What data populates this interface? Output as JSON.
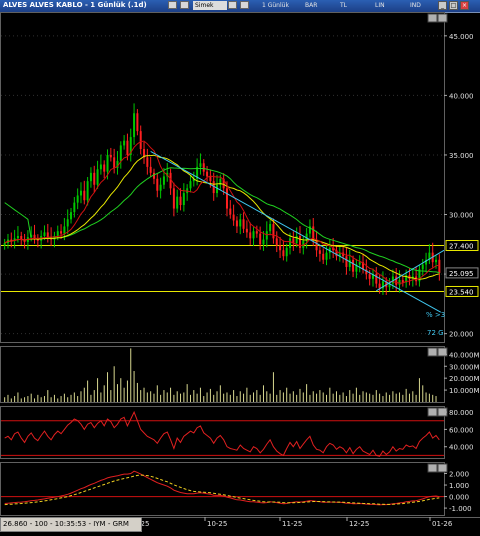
{
  "window": {
    "title": "ALVES ALVES KABLO - 1 Günlük (.1d)",
    "toolbar": {
      "field1": "Simek",
      "period": "1 Günlük",
      "bar": "BAR",
      "tl": "TL",
      "lin": "LIN",
      "ind": "IND"
    }
  },
  "status": {
    "text": "26.860 - 100 - 10:35:53 - IYM - GRM"
  },
  "colors": {
    "up": "#00c800",
    "down": "#ff2020",
    "ma_green": "#20d020",
    "ma_yellow": "#e8e800",
    "ma_red": "#d01010",
    "trend": "#40c8f0",
    "hline": "#e8e800",
    "grid": "#303030"
  },
  "chart_data": [
    {
      "type": "candlestick",
      "name": "price",
      "ylim": [
        19.3,
        47.0
      ],
      "yticks": [
        "45.000",
        "40.000",
        "35.000",
        "30.000",
        "25.000",
        "20.000"
      ],
      "xlabels": [
        "-25",
        "10-25",
        "11-25",
        "12-25",
        "01-26"
      ],
      "hlines": [
        {
          "value": 27.4,
          "label": "27.400"
        },
        {
          "value": 23.54,
          "label": "23.540"
        }
      ],
      "last_price": "25.095",
      "annotations": [
        "% >3",
        "72 G"
      ],
      "trendlines": [
        {
          "from_bar": 1,
          "to_bar": 2
        },
        {
          "from_bar": 3,
          "to_bar": 4
        }
      ],
      "closes": [
        27.6,
        27.9,
        27.8,
        28.0,
        28.2,
        27.9,
        27.7,
        28.1,
        28.3,
        28.0,
        27.8,
        28.2,
        28.5,
        28.1,
        27.9,
        28.2,
        28.6,
        28.4,
        29.0,
        29.6,
        30.2,
        31.0,
        31.6,
        32.0,
        31.2,
        32.8,
        33.5,
        32.5,
        33.8,
        34.2,
        33.6,
        35.0,
        34.8,
        33.9,
        34.5,
        35.8,
        36.2,
        35.0,
        36.5,
        38.5,
        37.0,
        35.5,
        34.8,
        34.0,
        33.5,
        33.0,
        32.0,
        32.5,
        33.2,
        33.5,
        32.2,
        30.5,
        31.5,
        30.8,
        31.8,
        32.2,
        32.8,
        33.0,
        34.0,
        34.3,
        33.6,
        33.2,
        32.8,
        31.8,
        32.5,
        33.0,
        32.2,
        30.5,
        30.0,
        29.5,
        29.0,
        29.6,
        28.8,
        28.5,
        28.0,
        28.6,
        28.4,
        27.5,
        27.9,
        28.6,
        29.2,
        28.0,
        27.4,
        27.0,
        26.5,
        27.2,
        28.0,
        27.6,
        28.2,
        27.2,
        27.8,
        28.4,
        29.0,
        27.8,
        27.0,
        26.7,
        26.2,
        26.8,
        27.2,
        27.0,
        26.5,
        26.8,
        26.5,
        25.6,
        26.2,
        25.2,
        25.8,
        26.0,
        25.4,
        25.0,
        24.6,
        25.0,
        24.2,
        23.8,
        24.4,
        23.9,
        24.2,
        24.8,
        24.1,
        24.5,
        24.3,
        24.9,
        24.6,
        24.8,
        24.4,
        25.4,
        25.8,
        26.2,
        26.8,
        26.0,
        26.2,
        25.1
      ]
    },
    {
      "type": "bar",
      "name": "volume",
      "ylim": [
        0,
        47000000
      ],
      "yticks": [
        "40.000M",
        "30.000M",
        "20.000M",
        "10.000M"
      ],
      "values": [
        4,
        6,
        3,
        5,
        8,
        3,
        4,
        5,
        7,
        3,
        6,
        4,
        5,
        10,
        4,
        6,
        3,
        5,
        7,
        4,
        6,
        8,
        5,
        9,
        12,
        18,
        6,
        10,
        20,
        8,
        14,
        25,
        10,
        30,
        15,
        20,
        12,
        18,
        45,
        26,
        16,
        10,
        12,
        8,
        9,
        7,
        14,
        6,
        10,
        8,
        12,
        6,
        9,
        7,
        8,
        15,
        6,
        10,
        7,
        12,
        5,
        8,
        11,
        6,
        9,
        14,
        7,
        8,
        6,
        10,
        5,
        9,
        7,
        12,
        6,
        8,
        10,
        6,
        14,
        9,
        7,
        25,
        6,
        10,
        8,
        12,
        7,
        9,
        6,
        11,
        8,
        15,
        6,
        9,
        7,
        10,
        8,
        6,
        12,
        7,
        9,
        6,
        8,
        5,
        10,
        7,
        12,
        6,
        9,
        8,
        7,
        6,
        10,
        7,
        5,
        8,
        6,
        9,
        7,
        8,
        6,
        11,
        7,
        9,
        6,
        20,
        14,
        8,
        7,
        6,
        5
      ]
    },
    {
      "type": "line",
      "name": "rsi",
      "ylim": [
        27,
        87
      ],
      "yticks": [
        "80.000",
        "60.000",
        "40.000"
      ],
      "hlines": [
        70,
        30
      ],
      "values": [
        50,
        52,
        48,
        55,
        57,
        50,
        45,
        52,
        56,
        50,
        47,
        53,
        58,
        52,
        48,
        54,
        58,
        55,
        60,
        65,
        68,
        72,
        70,
        66,
        60,
        66,
        68,
        62,
        67,
        70,
        64,
        72,
        69,
        62,
        66,
        72,
        74,
        64,
        72,
        80,
        70,
        60,
        56,
        52,
        50,
        48,
        44,
        50,
        55,
        57,
        48,
        38,
        50,
        45,
        52,
        55,
        58,
        56,
        62,
        64,
        56,
        53,
        50,
        44,
        50,
        53,
        48,
        40,
        38,
        37,
        36,
        42,
        38,
        36,
        34,
        40,
        38,
        33,
        37,
        43,
        48,
        40,
        35,
        32,
        30,
        38,
        45,
        40,
        46,
        38,
        43,
        48,
        52,
        42,
        37,
        36,
        33,
        40,
        44,
        42,
        37,
        40,
        38,
        33,
        39,
        32,
        37,
        40,
        35,
        33,
        31,
        36,
        30,
        29,
        35,
        31,
        34,
        40,
        35,
        38,
        37,
        42,
        40,
        41,
        38,
        46,
        50,
        53,
        57,
        50,
        53,
        48
      ]
    },
    {
      "type": "line",
      "name": "macd",
      "ylim": [
        -1.6,
        3.0
      ],
      "yticks": [
        "2.000",
        "1.000",
        "0.000",
        "-1.000"
      ],
      "hlines": [
        0.0
      ],
      "macd": [
        -0.6,
        -0.58,
        -0.55,
        -0.52,
        -0.5,
        -0.48,
        -0.45,
        -0.4,
        -0.36,
        -0.33,
        -0.3,
        -0.25,
        -0.2,
        -0.15,
        -0.1,
        -0.05,
        0.0,
        0.05,
        0.12,
        0.2,
        0.3,
        0.42,
        0.55,
        0.68,
        0.78,
        0.92,
        1.05,
        1.15,
        1.28,
        1.4,
        1.5,
        1.62,
        1.7,
        1.75,
        1.8,
        1.88,
        1.95,
        1.95,
        2.0,
        2.2,
        2.1,
        1.95,
        1.8,
        1.65,
        1.5,
        1.35,
        1.2,
        1.1,
        1.0,
        0.9,
        0.75,
        0.55,
        0.45,
        0.35,
        0.3,
        0.25,
        0.25,
        0.25,
        0.3,
        0.33,
        0.3,
        0.25,
        0.2,
        0.12,
        0.1,
        0.1,
        0.05,
        -0.05,
        -0.12,
        -0.2,
        -0.28,
        -0.3,
        -0.35,
        -0.4,
        -0.45,
        -0.45,
        -0.48,
        -0.52,
        -0.55,
        -0.52,
        -0.45,
        -0.48,
        -0.52,
        -0.58,
        -0.62,
        -0.6,
        -0.52,
        -0.5,
        -0.45,
        -0.48,
        -0.45,
        -0.4,
        -0.35,
        -0.38,
        -0.42,
        -0.45,
        -0.5,
        -0.5,
        -0.48,
        -0.48,
        -0.5,
        -0.5,
        -0.52,
        -0.58,
        -0.58,
        -0.62,
        -0.62,
        -0.6,
        -0.62,
        -0.65,
        -0.68,
        -0.66,
        -0.7,
        -0.72,
        -0.7,
        -0.7,
        -0.68,
        -0.62,
        -0.6,
        -0.55,
        -0.52,
        -0.45,
        -0.42,
        -0.38,
        -0.36,
        -0.28,
        -0.2,
        -0.1,
        0.0,
        0.02,
        0.05,
        0.0
      ],
      "signal": [
        -0.7,
        -0.68,
        -0.66,
        -0.64,
        -0.62,
        -0.6,
        -0.58,
        -0.55,
        -0.52,
        -0.5,
        -0.46,
        -0.42,
        -0.38,
        -0.33,
        -0.28,
        -0.23,
        -0.18,
        -0.12,
        -0.06,
        0.0,
        0.08,
        0.16,
        0.25,
        0.35,
        0.45,
        0.55,
        0.65,
        0.75,
        0.85,
        0.95,
        1.05,
        1.15,
        1.25,
        1.35,
        1.43,
        1.5,
        1.57,
        1.63,
        1.7,
        1.78,
        1.84,
        1.86,
        1.85,
        1.82,
        1.76,
        1.68,
        1.58,
        1.48,
        1.38,
        1.28,
        1.15,
        1.02,
        0.9,
        0.8,
        0.7,
        0.6,
        0.52,
        0.45,
        0.42,
        0.4,
        0.38,
        0.36,
        0.33,
        0.28,
        0.24,
        0.2,
        0.15,
        0.1,
        0.04,
        -0.02,
        -0.08,
        -0.13,
        -0.18,
        -0.23,
        -0.28,
        -0.33,
        -0.37,
        -0.41,
        -0.45,
        -0.47,
        -0.47,
        -0.47,
        -0.48,
        -0.5,
        -0.52,
        -0.54,
        -0.54,
        -0.53,
        -0.52,
        -0.51,
        -0.5,
        -0.48,
        -0.45,
        -0.43,
        -0.43,
        -0.43,
        -0.44,
        -0.45,
        -0.46,
        -0.47,
        -0.48,
        -0.48,
        -0.49,
        -0.51,
        -0.53,
        -0.55,
        -0.57,
        -0.58,
        -0.59,
        -0.6,
        -0.62,
        -0.63,
        -0.64,
        -0.66,
        -0.67,
        -0.68,
        -0.68,
        -0.67,
        -0.65,
        -0.63,
        -0.61,
        -0.57,
        -0.53,
        -0.5,
        -0.46,
        -0.42,
        -0.37,
        -0.31,
        -0.25,
        -0.2,
        -0.15,
        -0.12
      ]
    }
  ]
}
